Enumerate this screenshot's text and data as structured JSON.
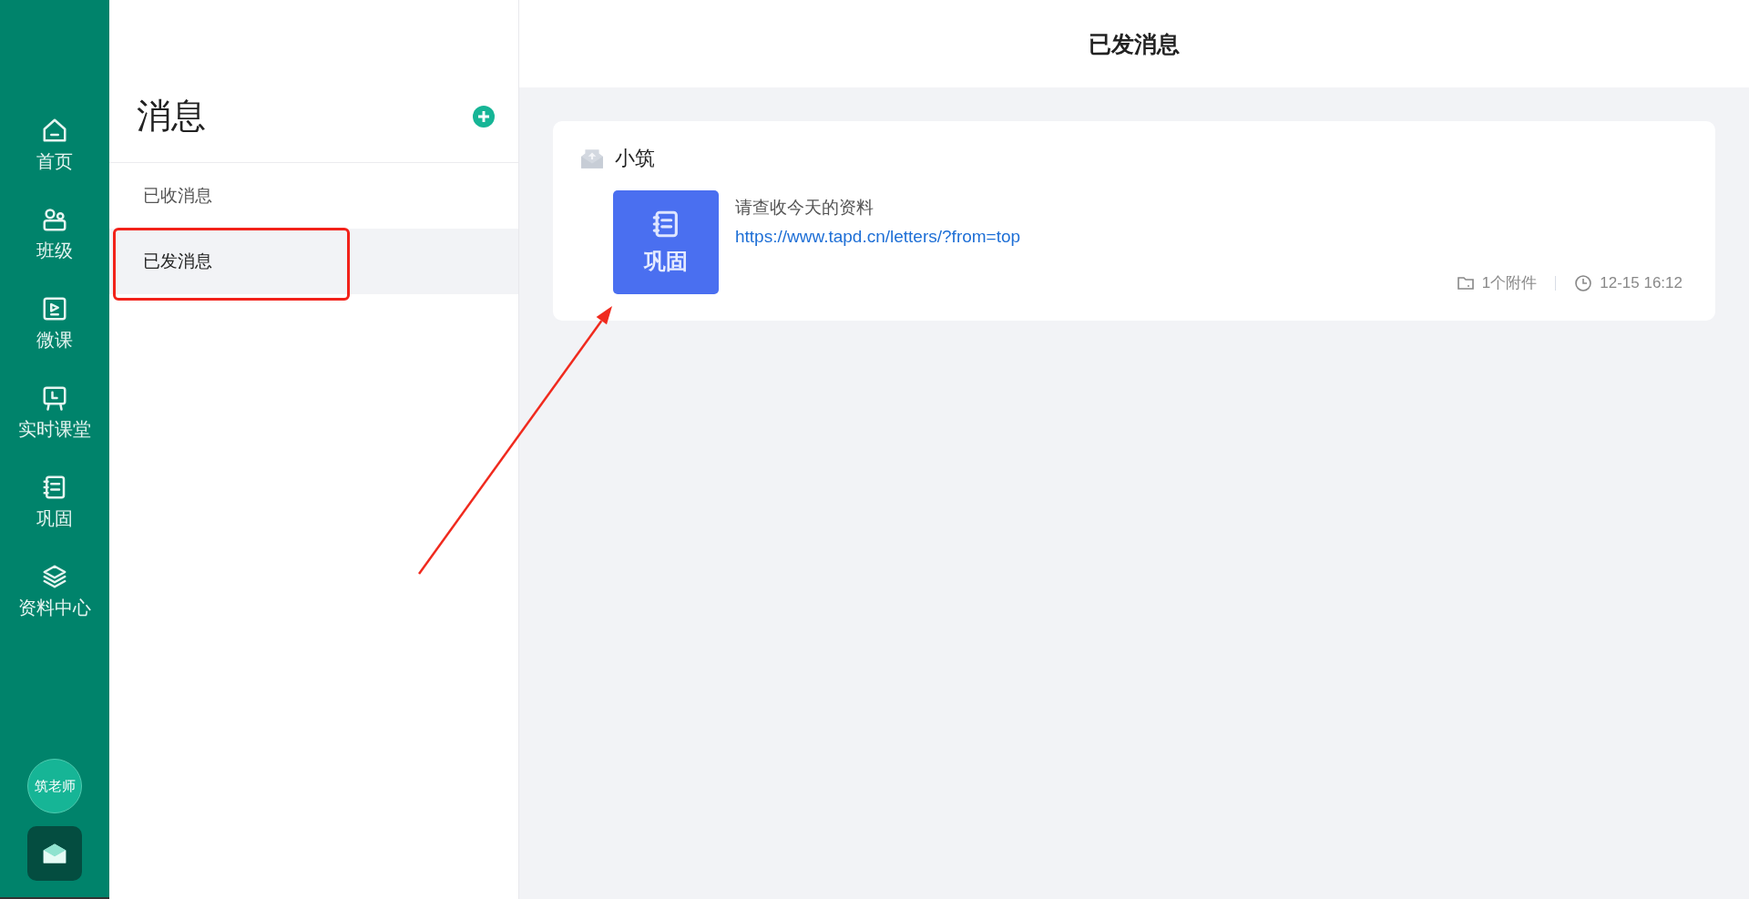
{
  "nav": {
    "items": [
      {
        "label": "首页",
        "selected": false
      },
      {
        "label": "班级",
        "selected": false
      },
      {
        "label": "微课",
        "selected": false
      },
      {
        "label": "实时课堂",
        "selected": false
      },
      {
        "label": "巩固",
        "selected": false
      },
      {
        "label": "资料中心",
        "selected": false
      }
    ],
    "user": {
      "avatar_text": "筑老师"
    }
  },
  "message_panel": {
    "title": "消息",
    "folders": [
      {
        "label": "已收消息",
        "selected": false
      },
      {
        "label": "已发消息",
        "selected": true
      }
    ]
  },
  "main": {
    "title": "已发消息",
    "messages": [
      {
        "sender": "小筑",
        "tile_label": "巩固",
        "text": "请查收今天的资料",
        "link": "https://www.tapd.cn/letters/?from=top",
        "attachments": "1个附件",
        "time": "12-15 16:12"
      }
    ]
  },
  "annotations": {
    "highlight_box": true,
    "arrow": true
  }
}
